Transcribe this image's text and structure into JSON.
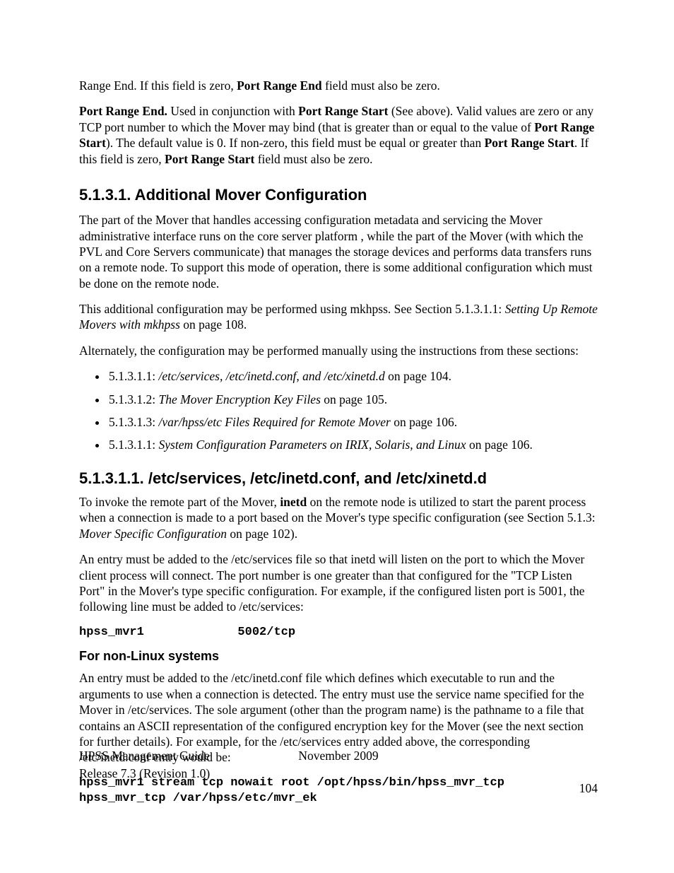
{
  "para_top": {
    "pre": "Range End. If this field is zero, ",
    "bold": "Port Range End",
    "post": " field must also be zero."
  },
  "para_pre": {
    "b1": "Port Range End.",
    "t1": " Used in conjunction with ",
    "b2": "Port Range Start",
    "t2": " (See above). Valid values are zero or any TCP port number to which the Mover may bind (that is greater than or equal to the value of ",
    "b3": "Port Range Start",
    "t3": "). The default value is 0. If non-zero, this field must be equal or greater than ",
    "b4": "Port Range Start",
    "t4": ". If this field is zero, ",
    "b5": "Port Range Start",
    "t5": " field must also be zero."
  },
  "h5131": "5.1.3.1.   Additional Mover Configuration",
  "p5131_a": "The part of the Mover that handles accessing configuration metadata and servicing the Mover administrative interface runs on the core server platform , while the part of the Mover (with which the PVL and Core Servers communicate) that manages the storage devices and performs data transfers runs on a remote node. To support this mode of operation, there is some additional configuration which must be done on the remote node.",
  "p5131_b": {
    "pre": "This additional configuration may be performed using mkhpss.  See Section 5.1.3.1.1: ",
    "ital": "Setting Up Remote Movers with mkhpss",
    "post": " on page 108."
  },
  "p5131_c": "Alternately, the configuration may be performed manually using the instructions from these sections:",
  "bullets": [
    {
      "num": "5.1.3.1.1: ",
      "ital": "/etc/services, /etc/inetd.conf, and /etc/xinetd.d",
      "post": " on page 104."
    },
    {
      "num": "5.1.3.1.2: ",
      "ital": "The Mover Encryption Key Files",
      "post": " on page 105."
    },
    {
      "num": "5.1.3.1.3: ",
      "ital": "/var/hpss/etc Files Required for Remote Mover",
      "post": " on page 106."
    },
    {
      "num": "5.1.3.1.1: ",
      "ital": "System Configuration Parameters on IRIX, Solaris, and Linux",
      "post": " on page 106."
    }
  ],
  "h51311": "5.1.3.1.1.   /etc/services, /etc/inetd.conf, and /etc/xinetd.d",
  "p51311_a": {
    "t1": "To invoke the remote part of the Mover, ",
    "b1": "inetd",
    "t2": " on the remote node is utilized to start the parent process when a connection is made to a port based on the Mover's type specific configuration (see Section  5.1.3: ",
    "ital": "Mover Specific Configuration",
    "t3": " on page 102)."
  },
  "p51311_b": "An entry must be added to the /etc/services file so that inetd will listen on the port to which the Mover client process will connect. The port number is one greater than that configured for the \"TCP Listen Port\" in the Mover's type specific configuration. For example, if the configured listen port is 5001, the following line must be added to /etc/services:",
  "code1": "hpss_mvr1             5002/tcp",
  "h_fornl": "For non-Linux systems",
  "p_fornl": "An  entry must be added to the /etc/inetd.conf file which defines which executable to run and the arguments to use when a connection is detected.  The entry must use the service name specified for the Mover in /etc/services. The sole argument (other than the program name) is the pathname to a file that contains an ASCII representation of the configured encryption key for the Mover (see the next section for further details). For example, for the /etc/services entry added above, the corresponding /etc/inetd.conf entry would be:",
  "code2": "hpss_mvr1 stream tcp nowait root /opt/hpss/bin/hpss_mvr_tcp\nhpss_mvr_tcp /var/hpss/etc/mvr_ek",
  "footer": {
    "guide": "HPSS Management Guide",
    "date": "November 2009",
    "release": "Release 7.3 (Revision 1.0)",
    "page": "104"
  }
}
